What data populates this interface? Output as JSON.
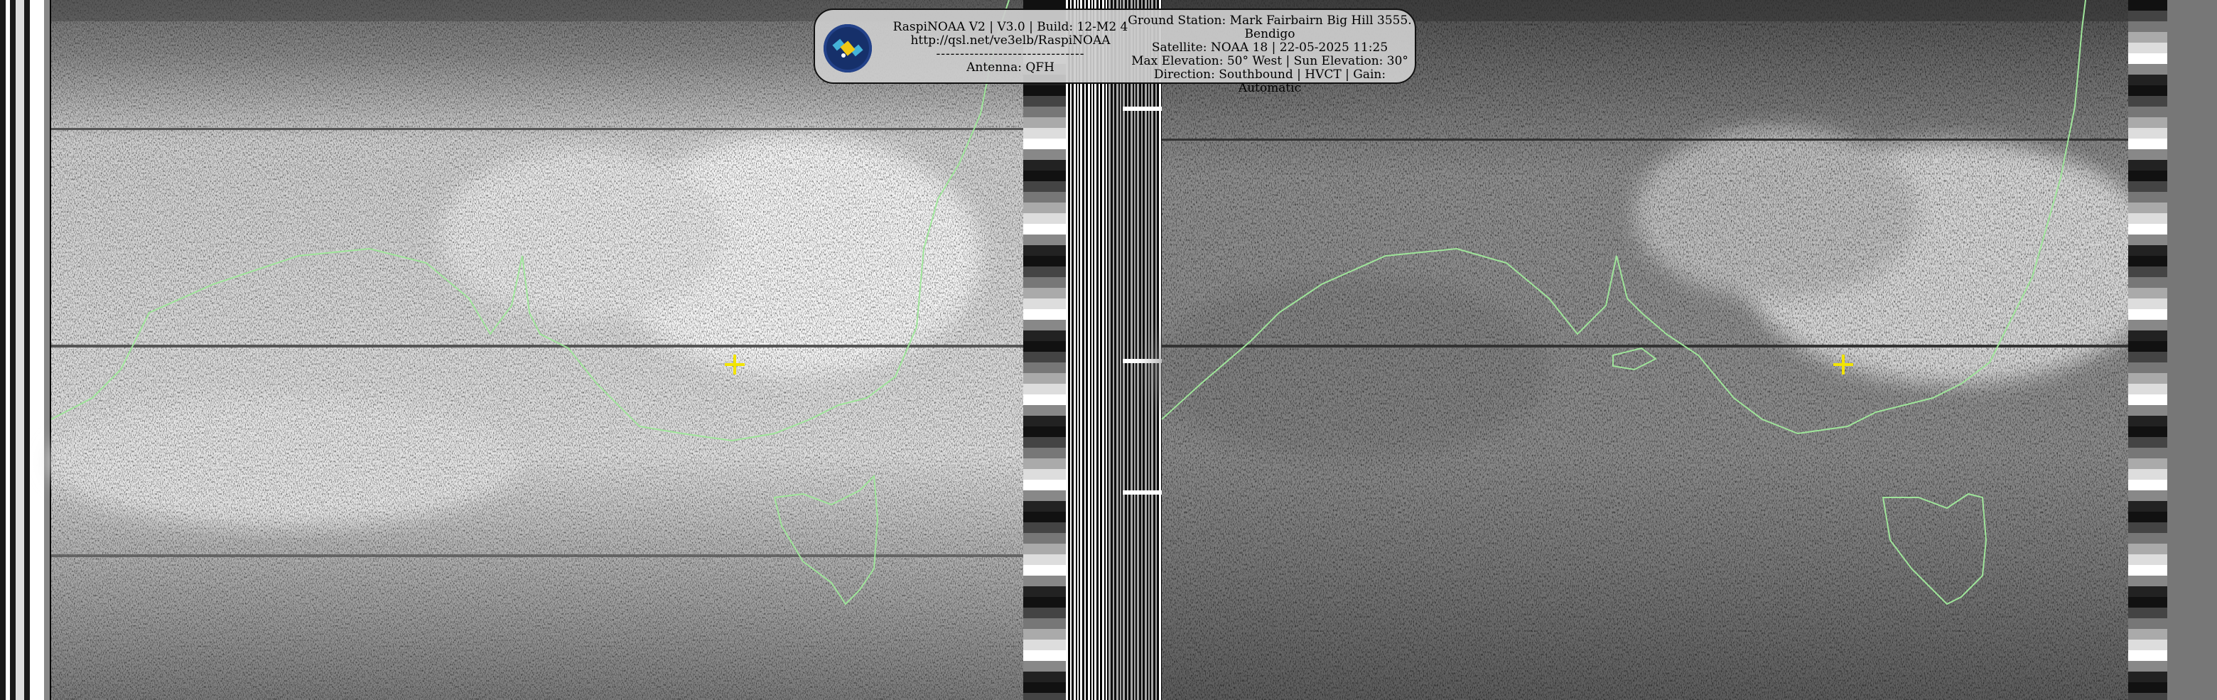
{
  "overlay": {
    "left_lines": [
      "RaspiNOAA V2 | V3.0 | Build: 12-M2 4",
      "http://qsl.net/ve3elb/RaspiNOAA",
      "-------------------------------",
      "Antenna: QFH"
    ],
    "right_lines": [
      "Ground Station: Mark Fairbairn Big Hill 3555.",
      "Bendigo",
      "Satellite: NOAA 18 | 22-05-2025 11:25",
      "Max Elevation: 50° West | Sun Elevation: 30°",
      "Direction: Southbound | HVCT | Gain: Automatic"
    ],
    "logo_icon": "satellite-icon"
  },
  "colors": {
    "coastline": "#9fe59a",
    "marker": "#f2e400",
    "overlay_bg": "#cccccc"
  },
  "images": {
    "channel_a": {
      "tone": "bright",
      "icon": "satellite-channel-a"
    },
    "channel_b": {
      "tone": "dark",
      "icon": "satellite-channel-b"
    }
  }
}
